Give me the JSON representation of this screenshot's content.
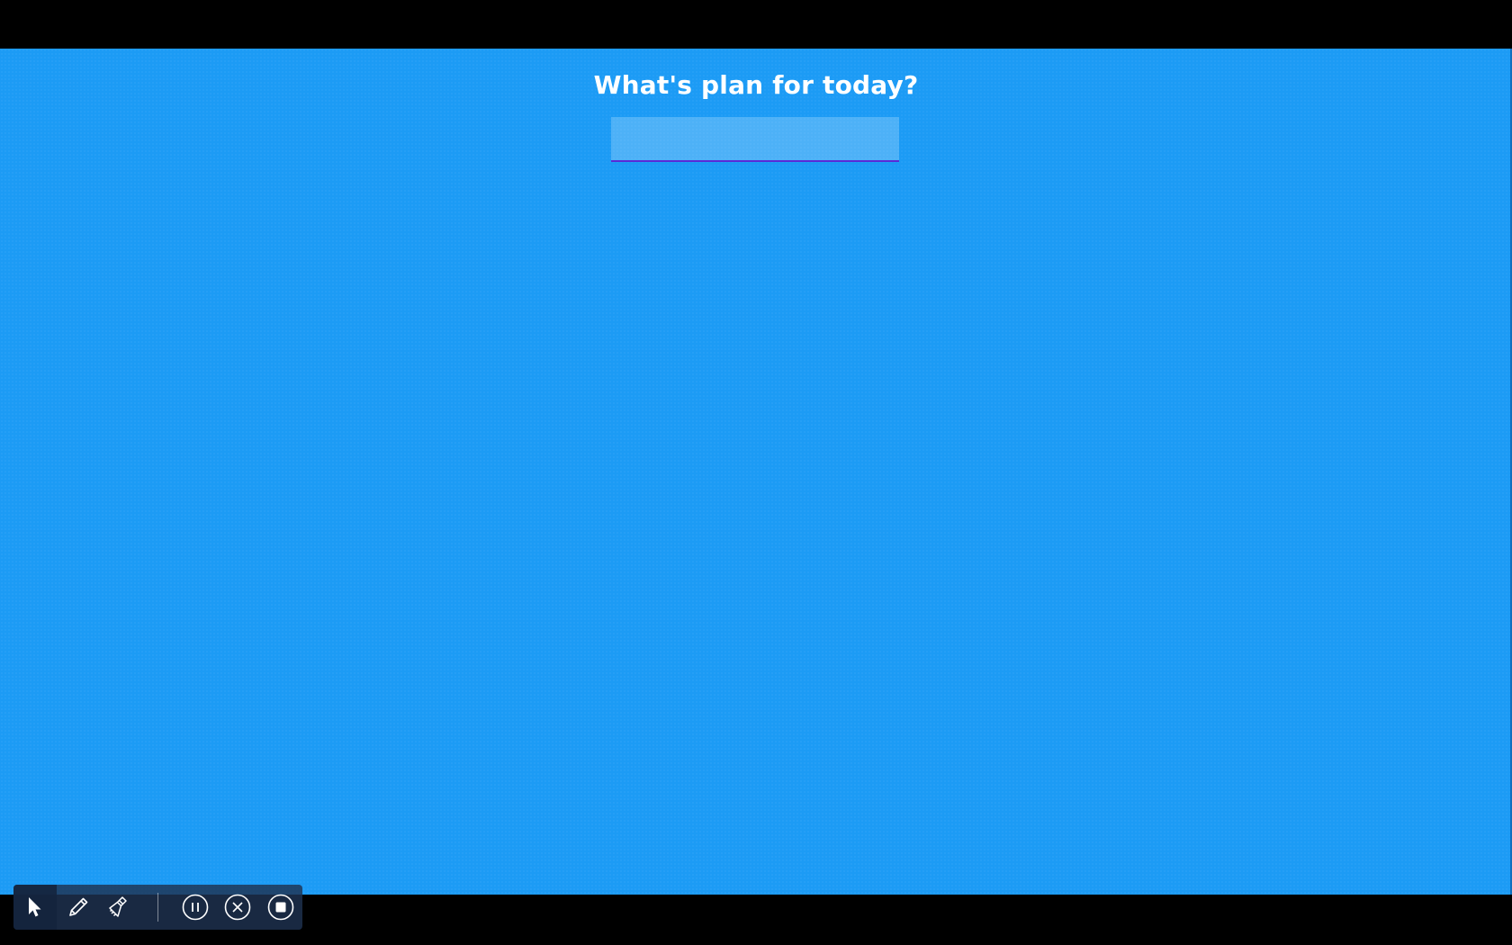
{
  "prompt": {
    "title": "What's plan for today?",
    "input_value": "",
    "input_placeholder": ""
  },
  "toolbar": {
    "tools": [
      {
        "name": "select",
        "icon": "cursor-icon",
        "active": true
      },
      {
        "name": "pen",
        "icon": "pencil-icon",
        "active": false
      },
      {
        "name": "highlighter",
        "icon": "brush-icon",
        "active": false
      }
    ],
    "controls": [
      {
        "name": "pause",
        "icon": "pause-icon"
      },
      {
        "name": "close",
        "icon": "close-icon"
      },
      {
        "name": "stop",
        "icon": "stop-icon"
      }
    ]
  },
  "colors": {
    "background": "#1c9bf5",
    "input_underline": "#5a2bd6",
    "toolbar": "#1e3250"
  }
}
